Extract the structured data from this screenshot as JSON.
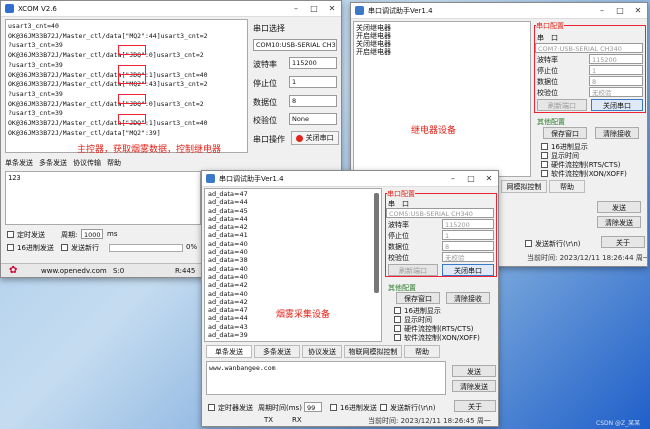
{
  "xcom": {
    "title": "XCOM V2.6",
    "log": [
      "usart3_cnt=40",
      "OK@36JM33B72J/Master_ctl/data[\"MQ2\":44]usart3_cnt=2",
      "?usart3_cnt=39",
      "OK@36JM33B72J/Master_ctl/data[\"JDQ\":0]usart3_cnt=2",
      "?usart3_cnt=39",
      "OK@36JM33B72J/Master_ctl/data[\"JDQ\":1]usart3_cnt=40",
      "OK@36JM33B72J/Master_ctl/data[\"MQ2\":43]usart3_cnt=2",
      "?usart3_cnt=39",
      "OK@36JM33B72J/Master_ctl/data[\"JDQ\":0]usart3_cnt=2",
      "?usart3_cnt=39",
      "OK@36JM33B72J/Master_ctl/data[\"JDQ\":1]usart3_cnt=40",
      "OK@36JM33B72J/Master_ctl/data[\"MQ2\":39]"
    ],
    "annotation": "主控器，获取烟雾数据，控制继电器",
    "port_select_label": "串口选择",
    "port_value": "COM10:USB-SERIAL CH34",
    "baud_label": "波特率",
    "baud_value": "115200",
    "stop_label": "停止位",
    "stop_value": "1",
    "data_label": "数据位",
    "data_value": "8",
    "parity_label": "校验位",
    "parity_value": "None",
    "port_op_label": "串口操作",
    "close_port": "关闭串口",
    "tabs": [
      "单条发送",
      "多条发送",
      "协议传输",
      "帮助"
    ],
    "send_text": "123",
    "timed_send": "定时发送",
    "period_label": "周期:",
    "period_value": "1000",
    "ms": "ms",
    "hex_send": "16进制发送",
    "send_newline": "发送新行",
    "progress": "0%",
    "website": "www.openedv.com",
    "status_s": "S:0",
    "status_r": "R:445"
  },
  "relay": {
    "title": "串口调试助手Ver1.4",
    "log": [
      "关闭继电器",
      "开启继电器",
      "关闭继电器",
      "开启继电器"
    ],
    "annotation": "继电器设备",
    "cfg_title": "串口配置",
    "port_label": "串　口",
    "port_value": "COM7:USB-SERIAL CH340",
    "baud_label": "波特率",
    "baud_value": "115200",
    "stop_label": "停止位",
    "stop_value": "1",
    "data_label": "数据位",
    "data_value": "8",
    "parity_label": "校验位",
    "parity_value": "无校验",
    "refresh": "刷新端口",
    "close": "关闭串口",
    "other_title": "其他配置",
    "save_window": "保存窗口",
    "clear_recv": "清除接收",
    "opts": [
      "16进制显示",
      "显示时间",
      "硬件流控制(RTS/CTS)",
      "软件流控制(XON/XOFF)"
    ],
    "iot_tab": "网模拟控制",
    "help_tab": "帮助",
    "send": "发送",
    "clear_send": "清除发送",
    "send_newline": "发送新行(\\r\\n)",
    "about": "关于",
    "time": "当前时间: 2023/12/11 18:26:44 周一"
  },
  "smoke": {
    "title": "串口调试助手Ver1.4",
    "log": [
      "ad_data=47",
      "ad_data=44",
      "ad_data=45",
      "ad_data=44",
      "ad_data=42",
      "ad_data=41",
      "ad_data=40",
      "ad_data=40",
      "ad_data=38",
      "ad_data=40",
      "ad_data=40",
      "ad_data=42",
      "ad_data=40",
      "ad_data=42",
      "ad_data=47",
      "ad_data=44",
      "ad_data=43",
      "ad_data=39"
    ],
    "annotation": "烟雾采集设备",
    "cfg_title": "串口配置",
    "port_label": "串　口",
    "port_value": "COM5:USB-SERIAL CH340",
    "baud_label": "波特率",
    "baud_value": "115200",
    "stop_label": "停止位",
    "stop_value": "1",
    "data_label": "数据位",
    "data_value": "8",
    "parity_label": "校验位",
    "parity_value": "无校验",
    "refresh": "刷新端口",
    "close": "关闭串口",
    "other_title": "其他配置",
    "save_window": "保存窗口",
    "clear_recv": "清除接收",
    "opts": [
      "16进制显示",
      "显示时间",
      "硬件流控制(RTS/CTS)",
      "软件流控制(XON/XOFF)"
    ],
    "tabs": [
      "单条发送",
      "多条发送",
      "协议发送",
      "物联网模拟控制",
      "帮助"
    ],
    "send_text": "www.wanbangee.com",
    "send": "发送",
    "clear_send": "清除发送",
    "timed_send": "定时器发送",
    "period_label": "周期时间(ms)",
    "period_value": "99",
    "hex_send": "16进制发送",
    "send_newline": "发送新行(\\r\\n)",
    "about": "关于",
    "tx": "TX",
    "rx": "RX",
    "time": "当前时间: 2023/12/11 18:26:45 周一"
  },
  "watermark": "CSDN @Z_某某"
}
